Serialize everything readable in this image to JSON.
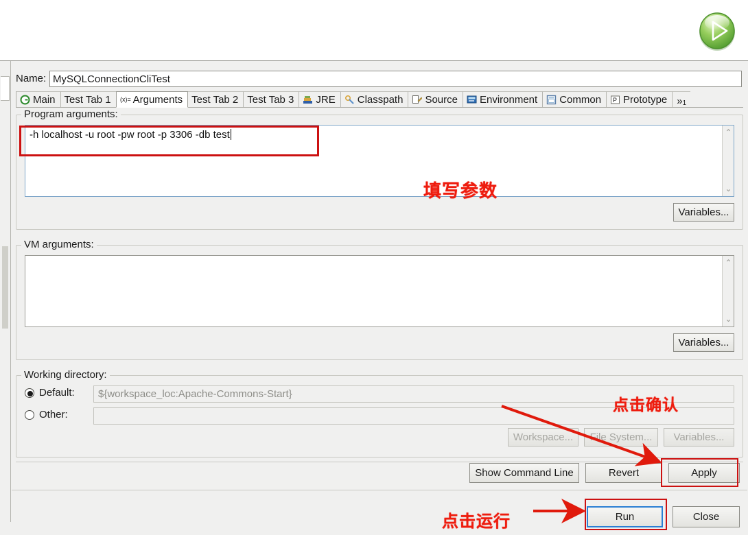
{
  "header": {
    "run_icon": "green-play-circle-icon"
  },
  "dialog": {
    "name_label": "Name:",
    "name_value": "MySQLConnectionCliTest",
    "tabs": [
      {
        "label": "Main",
        "icon": "java-main-class-icon",
        "selected": false
      },
      {
        "label": "Test Tab 1",
        "icon": "",
        "selected": false
      },
      {
        "label": "Arguments",
        "icon": "variable-xeq-icon",
        "selected": true
      },
      {
        "label": "Test Tab 2",
        "icon": "",
        "selected": false
      },
      {
        "label": "Test Tab 3",
        "icon": "",
        "selected": false
      },
      {
        "label": "JRE",
        "icon": "jre-library-icon",
        "selected": false
      },
      {
        "label": "Classpath",
        "icon": "classpath-icon",
        "selected": false
      },
      {
        "label": "Source",
        "icon": "source-icon",
        "selected": false
      },
      {
        "label": "Environment",
        "icon": "environment-icon",
        "selected": false
      },
      {
        "label": "Common",
        "icon": "common-icon",
        "selected": false
      },
      {
        "label": "Prototype",
        "icon": "prototype-p-icon",
        "selected": false
      }
    ],
    "tab_overflow": "»",
    "tab_overflow_count": "1"
  },
  "program_arguments": {
    "label": "Program arguments:",
    "value": "-h localhost -u root -pw root -p 3306 -db test",
    "placeholder": "",
    "variables_button": "Variables..."
  },
  "vm_arguments": {
    "label": "VM arguments:",
    "value": "",
    "placeholder": "",
    "variables_button": "Variables..."
  },
  "working_directory": {
    "label": "Working directory:",
    "default_label": "Default:",
    "default_selected": true,
    "default_value": "${workspace_loc:Apache-Commons-Start}",
    "other_label": "Other:",
    "other_selected": false,
    "other_value": "",
    "workspace_button": "Workspace...",
    "file_system_button": "File System...",
    "variables_button": "Variables..."
  },
  "footer": {
    "show_command_line": "Show Command Line",
    "revert": "Revert",
    "apply": "Apply",
    "run": "Run",
    "close": "Close"
  },
  "annotations": {
    "fill_params": "填写参数",
    "click_confirm": "点击确认",
    "click_run": "点击运行",
    "color": "#ee1c0e"
  }
}
